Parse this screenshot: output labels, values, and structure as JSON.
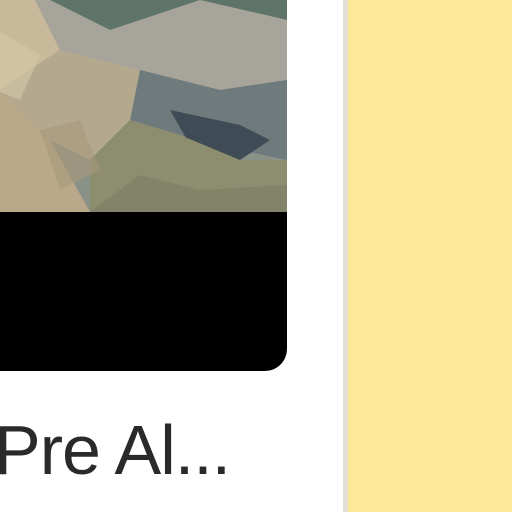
{
  "album_card": {
    "title": "Pre Al..."
  },
  "colors": {
    "card_background": "#000000",
    "side_panel": "#fce998",
    "title_text": "#2a2a2a"
  }
}
